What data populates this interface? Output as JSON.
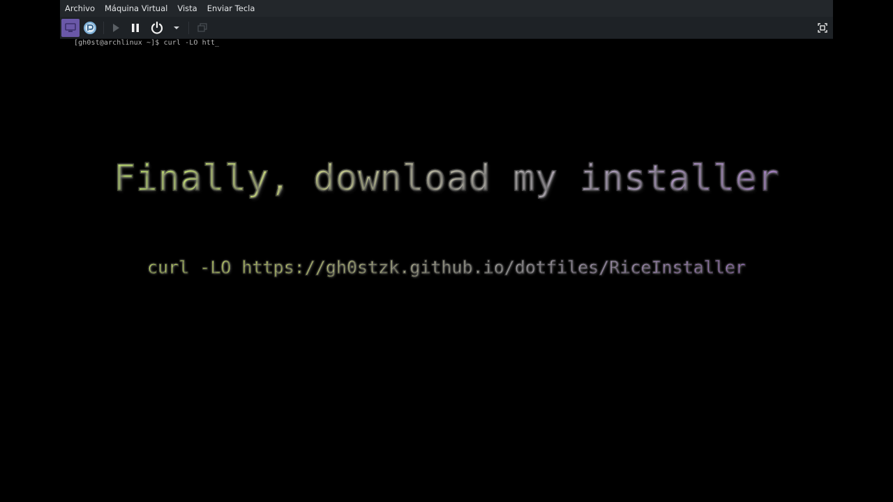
{
  "menubar": {
    "items": [
      {
        "label": "Archivo"
      },
      {
        "label": "Máquina Virtual"
      },
      {
        "label": "Vista"
      },
      {
        "label": "Enviar Tecla"
      }
    ]
  },
  "toolbar": {
    "buttons": [
      {
        "icon": "console-icon",
        "state": "active"
      },
      {
        "icon": "tools-icon"
      },
      {
        "icon": "play-icon",
        "state": "disabled"
      },
      {
        "icon": "pause-icon"
      },
      {
        "icon": "power-icon"
      },
      {
        "icon": "chevron-down-icon"
      },
      {
        "icon": "snapshot-icon",
        "state": "disabled"
      },
      {
        "icon": "fullscreen-icon"
      }
    ],
    "accent_color": "#6a58a8"
  },
  "terminal": {
    "prompt_line": "[gh0st@archlinux ~]$ curl -LO htt_"
  },
  "overlay": {
    "title": "Finally, download my installer",
    "command": "curl -LO https://gh0stzk.github.io/dotfiles/RiceInstaller",
    "gradient_colors": [
      "#b4ea3c",
      "#a7a2a1",
      "#9b5fcf"
    ]
  }
}
